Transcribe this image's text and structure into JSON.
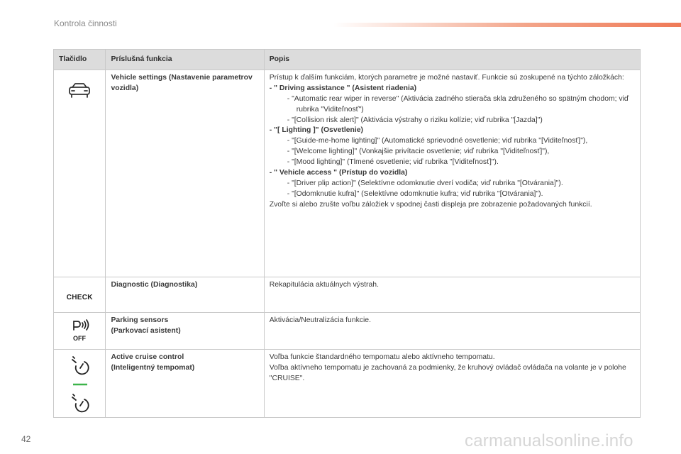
{
  "page": {
    "section_title": "Kontrola činnosti",
    "page_number": "42",
    "watermark": "carmanualsonline.info"
  },
  "table": {
    "headers": [
      "Tlačidlo",
      "Príslušná funkcia",
      "Popis"
    ],
    "rows": [
      {
        "icon": "car-settings-icon",
        "function": "Vehicle settings (Nastavenie parametrov vozidla)",
        "desc": {
          "intro": "Prístup k ďalším funkciám, ktorých parametre je možné nastaviť. Funkcie sú zoskupené na týchto záložkách:",
          "g1": "- \" Driving assistance \" (Asistent riadenia)",
          "g1_i1": "- \"Automatic rear wiper in reverse\" (Aktivácia zadného stierača skla združeného so spätným chodom; viď rubrika \"Viditeľnosť\")",
          "g1_i2": "- \"[Collision risk alert]\" (Aktivácia výstrahy o riziku kolízie; viď rubrika \"[Jazda]\")",
          "g2": "- \"[ Lighting ]\" (Osvetlenie)",
          "g2_i1": "- \"[Guide-me-home lighting]\" (Automatické sprievodné osvetlenie; viď rubrika \"[Viditeľnosť]\"),",
          "g2_i2": "- \"[Welcome lighting]\" (Vonkajšie privítacie osvetlenie; viď rubrika \"[Viditeľnosť]\"),",
          "g2_i3": "- \"[Mood lighting]\" (Tlmené osvetlenie; viď rubrika \"[Viditeľnosť]\").",
          "g3": "- \" Vehicle access \" (Prístup do vozidla)",
          "g3_i1": "- \"[Driver plip action]\" (Selektívne odomknutie dverí vodiča; viď rubrika \"[Otvárania]\").",
          "g3_i2": "- \"[Odomknutie kufra]\" (Selektívne odomknutie kufra; viď rubrika \"[Otvárania]\").",
          "outro": "Zvoľte si alebo zrušte voľbu záložiek v spodnej časti displeja pre zobrazenie požadovaných funkcií."
        }
      },
      {
        "icon_text": "CHECK",
        "function": "Diagnostic (Diagnostika)",
        "desc": "Rekapitulácia aktuálnych výstrah."
      },
      {
        "icon": "parking-sensors-off-icon",
        "icon_text": "OFF",
        "function_l1": "Parking sensors",
        "function_l2": "(Parkovací asistent)",
        "desc": "Aktivácia/Neutralizácia funkcie."
      },
      {
        "icon": "cruise-control-icon",
        "function_l1": "Active cruise control",
        "function_l2": "(Inteligentný tempomat)",
        "desc_l1": "Voľba funkcie štandardného tempomatu alebo aktívneho tempomatu.",
        "desc_l2": "Voľba aktívneho tempomatu je zachovaná za podmienky, že kruhový ovládač ovládača na volante je v polohe \"CRUISE\"."
      }
    ]
  },
  "colors": {
    "header_bg": "#dcdcdc",
    "accent": "#ef7a57",
    "cruise_active": "#3cb44a"
  }
}
